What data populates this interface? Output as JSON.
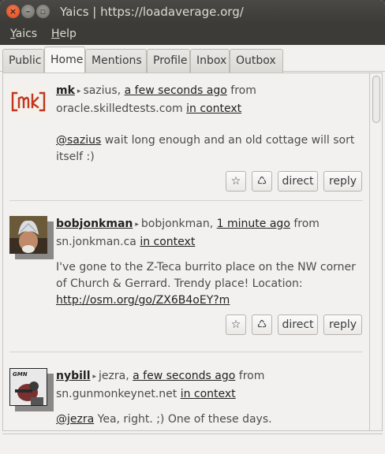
{
  "window": {
    "title": "Yaics | https://loadaverage.org/",
    "close_glyph": "×",
    "min_glyph": "–",
    "max_glyph": "▫"
  },
  "menu": {
    "items": [
      "Yaics",
      "Help"
    ]
  },
  "tabs": [
    "Public",
    "Home",
    "Mentions",
    "Profile",
    "Inbox",
    "Outbox"
  ],
  "active_tab": "Home",
  "actions": {
    "favorite_glyph": "☆",
    "repeat_glyph": "♺",
    "direct": "direct",
    "reply": "reply"
  },
  "posts": [
    {
      "nick": "mk",
      "user": "sazius",
      "time": "a few seconds ago",
      "from_word": "from",
      "source": "oracle.skilledtests.com",
      "context": "in context",
      "mention": "@sazius",
      "text": " wait long enough and an old cottage will sort itself :)"
    },
    {
      "nick": "bobjonkman",
      "user": "bobjonkman",
      "time": "1 minute ago",
      "from_word": "from",
      "source": "sn.jonkman.ca",
      "context": "in context",
      "text": "I've gone to the Z-Teca burrito place on the NW corner of Church & Gerrard. Trendy place! Location: ",
      "link": "http://osm.org/go/ZX6B4oEY?m"
    },
    {
      "nick": "nybill",
      "user": "jezra",
      "time": "a few seconds ago",
      "from_word": "from",
      "source": "sn.gunmonkeynet.net",
      "context": "in context",
      "mention": "@jezra",
      "text": " Yea, right. ;) One of these days."
    }
  ],
  "avatars": {
    "mk_logo": "[mk]",
    "nybill_tag": "GMN"
  },
  "colors": {
    "title_bg": "#3c3b37",
    "window_bg": "#f2f1f0",
    "close": "#df4a16"
  }
}
